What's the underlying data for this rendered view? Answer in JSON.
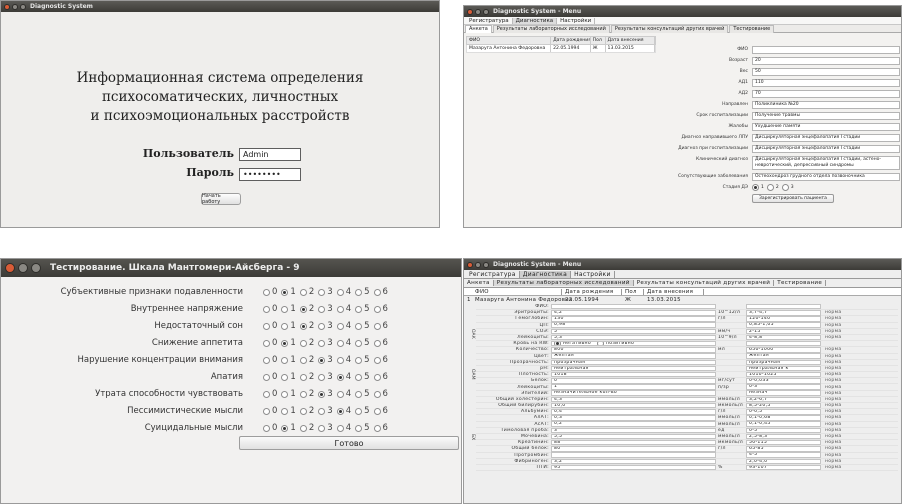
{
  "login": {
    "window_title": "Diagnostic System",
    "heading_line1": "Информационная система определения",
    "heading_line2": "психосоматических, личностных",
    "heading_line3": "и психоэмоциональных расстройств",
    "user_label": "Пользователь",
    "user_value": "Admin",
    "password_label": "Пароль",
    "password_value": "••••••••",
    "start_button": "Начать работу"
  },
  "main": {
    "window_title": "Diagnostic System - Menu",
    "menu": [
      "Регистратура",
      "Диагностика",
      "Настройки"
    ],
    "active_menu": 1,
    "tabs": [
      "Анкета",
      "Результаты лабораторных исследований",
      "Результаты консультаций других врачей",
      "Тестирование"
    ],
    "table_headers": [
      "ФИО",
      "Дата рождения",
      "Пол",
      "Дата внесения"
    ],
    "table_rows": [
      [
        "Мазаруга Антонина Федоровна",
        "22.05.1994",
        "Ж",
        "13.03.2015"
      ]
    ],
    "form": [
      {
        "label": "ФИО",
        "value": ""
      },
      {
        "label": "Возраст",
        "value": "20"
      },
      {
        "label": "Вес",
        "value": "50"
      },
      {
        "label": "АД1",
        "value": "110"
      },
      {
        "label": "АД2",
        "value": "70"
      },
      {
        "label": "Направлен",
        "value": "Поликлиника №20"
      },
      {
        "label": "Срок госпитализации",
        "value": "Получение травмы"
      },
      {
        "label": "Жалобы",
        "value": "Ухудшение памяти"
      },
      {
        "label": "Диагноз направившего ЛПУ",
        "value": "Дисциркуляторная энцефалопатия I стадии"
      },
      {
        "label": "Диагноз при госпитализации",
        "value": "Дисциркуляторная энцефалопатия I стадии"
      },
      {
        "label": "Клинический диагноз",
        "value": "Дисциркуляторная энцефалопатия I стадии, астено-невротический, депрессивный синдромы"
      },
      {
        "label": "Сопутствующие заболевания",
        "value": "Остеохондроз грудного отдела позвоночника"
      }
    ],
    "stage_label": "Стадия ДЭ",
    "stage_options": [
      "1",
      "2",
      "3"
    ],
    "stage_selected": 0,
    "register_button": "Зарегистрировать пациента"
  },
  "test": {
    "window_title": "Тестирование. Шкала Мантгомери-Айсберга - 9",
    "options": [
      "0",
      "1",
      "2",
      "3",
      "4",
      "5",
      "6"
    ],
    "items": [
      {
        "label": "Субъективные признаки подавленности",
        "selected": 1
      },
      {
        "label": "Внутреннее напряжение",
        "selected": 2
      },
      {
        "label": "Недостаточный сон",
        "selected": 2
      },
      {
        "label": "Снижение аппетита",
        "selected": 1
      },
      {
        "label": "Нарушение концентрации внимания",
        "selected": 3
      },
      {
        "label": "Апатия",
        "selected": 4
      },
      {
        "label": "Утрата способности чувствовать",
        "selected": 3
      },
      {
        "label": "Пессимистические мысли",
        "selected": 4
      },
      {
        "label": "Суицидальные мысли",
        "selected": 1
      }
    ],
    "done_button": "Готово"
  },
  "lab": {
    "window_title": "Diagnostic System - Menu",
    "menu": [
      "Регистратура",
      "Диагностика",
      "Настройки"
    ],
    "tabs": [
      "Анкета",
      "Результаты лабораторных исследований",
      "Результаты консультаций других врачей",
      "Тестирование"
    ],
    "headers": [
      "ФИО",
      "Дата рождения",
      "Пол",
      "Дата внесения"
    ],
    "patient": [
      "1",
      "Мазаруга Антонина Федоровна",
      "22.05.1994",
      "Ж",
      "13.03.2015"
    ],
    "side_labels": [
      "ОАК",
      "ОАМ",
      "БХ"
    ],
    "rows": [
      {
        "label": "ФИО:",
        "value": "",
        "unit": "",
        "ref": "",
        "status": ""
      },
      {
        "label": "Эритроциты:",
        "value": "4,2",
        "unit": "10^12/л",
        "ref": "3,7-4,7",
        "status": "норма"
      },
      {
        "label": "Гемоглобин:",
        "value": "130",
        "unit": "г/л",
        "ref": "120-140",
        "status": "норма"
      },
      {
        "label": "ЦП:",
        "value": "0,98",
        "unit": "",
        "ref": "0,85-1,05",
        "status": "норма"
      },
      {
        "label": "СОЭ:",
        "value": "5",
        "unit": "мм/ч",
        "ref": "2-15",
        "status": "норма"
      },
      {
        "label": "Лейкоциты:",
        "value": "5,3",
        "unit": "10^9/л",
        "ref": "4-8,8",
        "status": "норма"
      },
      {
        "label": "Кровь на RW:",
        "value": "negative",
        "unit": "",
        "ref": "",
        "status": ""
      },
      {
        "label": "Количество:",
        "value": "800",
        "unit": "мл",
        "ref": "650-1000",
        "status": "норма"
      },
      {
        "label": "Цвет:",
        "value": "желтая",
        "unit": "",
        "ref": "желтая",
        "status": "норма"
      },
      {
        "label": "Прозрачность:",
        "value": "прозрачная",
        "unit": "",
        "ref": "прозрачная",
        "status": "норма"
      },
      {
        "label": "pH:",
        "value": "нейтральная",
        "unit": "",
        "ref": "нейтральная к",
        "status": "норма"
      },
      {
        "label": "Плотность:",
        "value": "1018",
        "unit": "",
        "ref": "1010-1025",
        "status": "норма"
      },
      {
        "label": "Белок:",
        "value": "0",
        "unit": "мг/сут",
        "ref": "0-0,033",
        "status": "норма"
      },
      {
        "label": "Лейкоциты:",
        "value": "1",
        "unit": "п/зр",
        "ref": "0-3",
        "status": "норма"
      },
      {
        "label": "Эпителий:",
        "value": "незначительное кол-во",
        "unit": "",
        "ref": "незнач",
        "status": "норма"
      },
      {
        "label": "Общий холестерин:",
        "value": "4,3",
        "unit": "ммоль/л",
        "ref": "3,2-6,7",
        "status": "норма"
      },
      {
        "label": "Общий билирубин:",
        "value": "10,0",
        "unit": "мкмоль/л",
        "ref": "8,5-20,5",
        "status": "норма"
      },
      {
        "label": "Альбумин:",
        "value": "0,4",
        "unit": "г/л",
        "ref": "0-0,5",
        "status": "норма"
      },
      {
        "label": "АлАТ:",
        "value": "0,3",
        "unit": "ммоль/л",
        "ref": "0,1-0,68",
        "status": "норма"
      },
      {
        "label": "АсАТ:",
        "value": "0,2",
        "unit": "ммоль/л",
        "ref": "0,1-0,45",
        "status": "норма"
      },
      {
        "label": "Тимоловая проба:",
        "value": "3",
        "unit": "ед",
        "ref": "0-5",
        "status": "норма"
      },
      {
        "label": "Мочевина:",
        "value": "5,5",
        "unit": "ммоль/л",
        "ref": "2,5-8,3",
        "status": "норма"
      },
      {
        "label": "Креатинин:",
        "value": "88",
        "unit": "мкмоль/л",
        "ref": "50-115",
        "status": "норма"
      },
      {
        "label": "Общий белок:",
        "value": "80",
        "unit": "г/л",
        "ref": "65-85",
        "status": "норма"
      },
      {
        "label": "Протромбин:",
        "value": "",
        "unit": "",
        "ref": "4-5",
        "status": "норма"
      },
      {
        "label": "Фибриноген:",
        "value": "3,2",
        "unit": "",
        "ref": "2,0-4,0",
        "status": "норма"
      },
      {
        "label": "ПТИ:",
        "value": "95",
        "unit": "%",
        "ref": "93-107",
        "status": "норма"
      }
    ],
    "rw_options": [
      "негативно",
      "позитивно"
    ],
    "rw_selected": 0
  }
}
